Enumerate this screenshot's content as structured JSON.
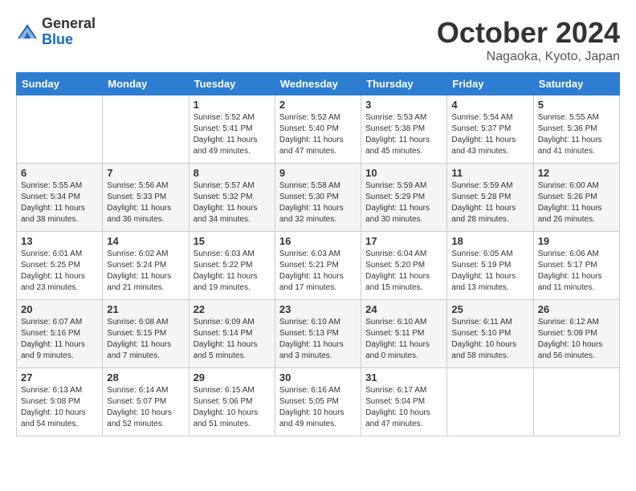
{
  "header": {
    "logo_general": "General",
    "logo_blue": "Blue",
    "month_title": "October 2024",
    "location": "Nagaoka, Kyoto, Japan"
  },
  "days_of_week": [
    "Sunday",
    "Monday",
    "Tuesday",
    "Wednesday",
    "Thursday",
    "Friday",
    "Saturday"
  ],
  "weeks": [
    [
      {
        "day": "",
        "info": ""
      },
      {
        "day": "",
        "info": ""
      },
      {
        "day": "1",
        "info": "Sunrise: 5:52 AM\nSunset: 5:41 PM\nDaylight: 11 hours and 49 minutes."
      },
      {
        "day": "2",
        "info": "Sunrise: 5:52 AM\nSunset: 5:40 PM\nDaylight: 11 hours and 47 minutes."
      },
      {
        "day": "3",
        "info": "Sunrise: 5:53 AM\nSunset: 5:38 PM\nDaylight: 11 hours and 45 minutes."
      },
      {
        "day": "4",
        "info": "Sunrise: 5:54 AM\nSunset: 5:37 PM\nDaylight: 11 hours and 43 minutes."
      },
      {
        "day": "5",
        "info": "Sunrise: 5:55 AM\nSunset: 5:36 PM\nDaylight: 11 hours and 41 minutes."
      }
    ],
    [
      {
        "day": "6",
        "info": "Sunrise: 5:55 AM\nSunset: 5:34 PM\nDaylight: 11 hours and 38 minutes."
      },
      {
        "day": "7",
        "info": "Sunrise: 5:56 AM\nSunset: 5:33 PM\nDaylight: 11 hours and 36 minutes."
      },
      {
        "day": "8",
        "info": "Sunrise: 5:57 AM\nSunset: 5:32 PM\nDaylight: 11 hours and 34 minutes."
      },
      {
        "day": "9",
        "info": "Sunrise: 5:58 AM\nSunset: 5:30 PM\nDaylight: 11 hours and 32 minutes."
      },
      {
        "day": "10",
        "info": "Sunrise: 5:59 AM\nSunset: 5:29 PM\nDaylight: 11 hours and 30 minutes."
      },
      {
        "day": "11",
        "info": "Sunrise: 5:59 AM\nSunset: 5:28 PM\nDaylight: 11 hours and 28 minutes."
      },
      {
        "day": "12",
        "info": "Sunrise: 6:00 AM\nSunset: 5:26 PM\nDaylight: 11 hours and 26 minutes."
      }
    ],
    [
      {
        "day": "13",
        "info": "Sunrise: 6:01 AM\nSunset: 5:25 PM\nDaylight: 11 hours and 23 minutes."
      },
      {
        "day": "14",
        "info": "Sunrise: 6:02 AM\nSunset: 5:24 PM\nDaylight: 11 hours and 21 minutes."
      },
      {
        "day": "15",
        "info": "Sunrise: 6:03 AM\nSunset: 5:22 PM\nDaylight: 11 hours and 19 minutes."
      },
      {
        "day": "16",
        "info": "Sunrise: 6:03 AM\nSunset: 5:21 PM\nDaylight: 11 hours and 17 minutes."
      },
      {
        "day": "17",
        "info": "Sunrise: 6:04 AM\nSunset: 5:20 PM\nDaylight: 11 hours and 15 minutes."
      },
      {
        "day": "18",
        "info": "Sunrise: 6:05 AM\nSunset: 5:19 PM\nDaylight: 11 hours and 13 minutes."
      },
      {
        "day": "19",
        "info": "Sunrise: 6:06 AM\nSunset: 5:17 PM\nDaylight: 11 hours and 11 minutes."
      }
    ],
    [
      {
        "day": "20",
        "info": "Sunrise: 6:07 AM\nSunset: 5:16 PM\nDaylight: 11 hours and 9 minutes."
      },
      {
        "day": "21",
        "info": "Sunrise: 6:08 AM\nSunset: 5:15 PM\nDaylight: 11 hours and 7 minutes."
      },
      {
        "day": "22",
        "info": "Sunrise: 6:09 AM\nSunset: 5:14 PM\nDaylight: 11 hours and 5 minutes."
      },
      {
        "day": "23",
        "info": "Sunrise: 6:10 AM\nSunset: 5:13 PM\nDaylight: 11 hours and 3 minutes."
      },
      {
        "day": "24",
        "info": "Sunrise: 6:10 AM\nSunset: 5:11 PM\nDaylight: 11 hours and 0 minutes."
      },
      {
        "day": "25",
        "info": "Sunrise: 6:11 AM\nSunset: 5:10 PM\nDaylight: 10 hours and 58 minutes."
      },
      {
        "day": "26",
        "info": "Sunrise: 6:12 AM\nSunset: 5:09 PM\nDaylight: 10 hours and 56 minutes."
      }
    ],
    [
      {
        "day": "27",
        "info": "Sunrise: 6:13 AM\nSunset: 5:08 PM\nDaylight: 10 hours and 54 minutes."
      },
      {
        "day": "28",
        "info": "Sunrise: 6:14 AM\nSunset: 5:07 PM\nDaylight: 10 hours and 52 minutes."
      },
      {
        "day": "29",
        "info": "Sunrise: 6:15 AM\nSunset: 5:06 PM\nDaylight: 10 hours and 51 minutes."
      },
      {
        "day": "30",
        "info": "Sunrise: 6:16 AM\nSunset: 5:05 PM\nDaylight: 10 hours and 49 minutes."
      },
      {
        "day": "31",
        "info": "Sunrise: 6:17 AM\nSunset: 5:04 PM\nDaylight: 10 hours and 47 minutes."
      },
      {
        "day": "",
        "info": ""
      },
      {
        "day": "",
        "info": ""
      }
    ]
  ]
}
